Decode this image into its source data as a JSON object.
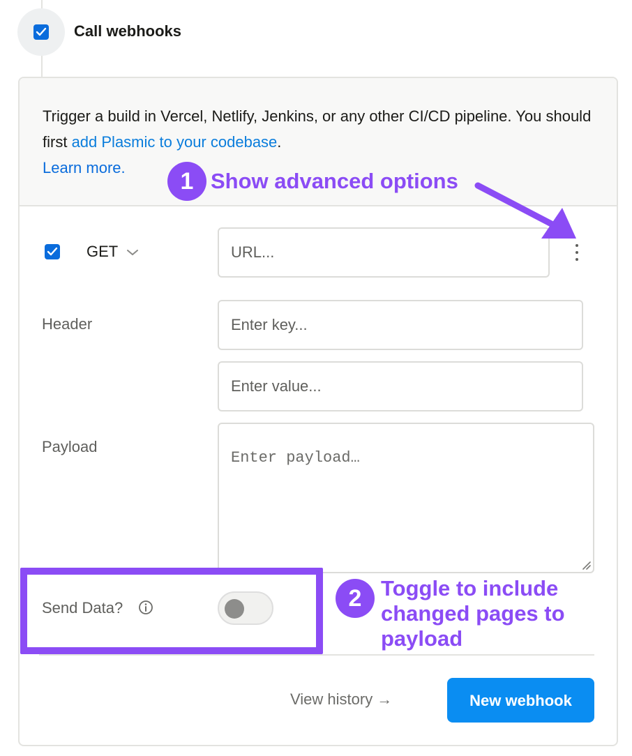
{
  "step": {
    "title": "Call webhooks",
    "checked": true
  },
  "intro": {
    "text_before": "Trigger a build in Vercel, Netlify, Jenkins, or any other CI/CD pipeline. You should first ",
    "link_text": "add Plasmic to your codebase",
    "text_after": ".",
    "learn_more": "Learn more."
  },
  "webhook": {
    "enabled": true,
    "method": "GET",
    "url_placeholder": "URL...",
    "header_label": "Header",
    "key_placeholder": "Enter key...",
    "value_placeholder": "Enter value...",
    "payload_label": "Payload",
    "payload_placeholder": "Enter payload…",
    "send_data_label": "Send Data?",
    "send_data_enabled": false
  },
  "footer": {
    "view_history": "View history →",
    "new_webhook": "New webhook"
  },
  "annotations": {
    "one": {
      "number": "1",
      "text": "Show advanced options"
    },
    "two": {
      "number": "2",
      "text": "Toggle to include changed pages to payload"
    },
    "accent_color": "#8b4cf5"
  },
  "colors": {
    "primary_blue": "#0a8df2",
    "link_blue": "#0a7ddc"
  }
}
